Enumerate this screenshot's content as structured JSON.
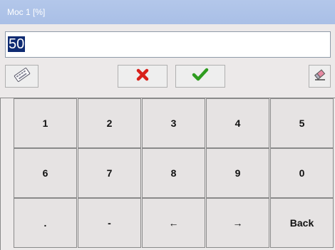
{
  "dialog": {
    "title": "Moc 1 [%]",
    "value": "50"
  },
  "toolbar": {
    "keyboard_icon": "keyboard-icon",
    "cancel_icon": "red-x-icon",
    "confirm_icon": "green-check-icon",
    "clear_icon": "eraser-icon"
  },
  "keypad": {
    "keys": [
      "1",
      "2",
      "3",
      "4",
      "5",
      "6",
      "7",
      "8",
      "9",
      "0",
      ".",
      "-",
      "←",
      "→",
      "Back"
    ]
  },
  "colors": {
    "title_bar": "#a9bfe6",
    "selection": "#0f2b72",
    "cancel": "#d8201a",
    "confirm": "#2e9c1f"
  }
}
